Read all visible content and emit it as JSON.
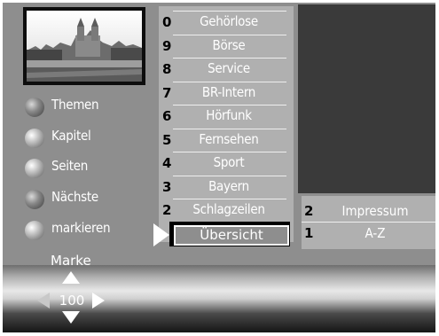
{
  "menu": [
    {
      "label": "Themen"
    },
    {
      "label": "Kapitel"
    },
    {
      "label": "Seiten"
    },
    {
      "label": "Nächste"
    },
    {
      "label": "markieren"
    }
  ],
  "marke_label": "Marke",
  "list": [
    {
      "num": "0",
      "name": "Gehörlose"
    },
    {
      "num": "9",
      "name": "Börse"
    },
    {
      "num": "8",
      "name": "Service"
    },
    {
      "num": "7",
      "name": "BR-Intern"
    },
    {
      "num": "6",
      "name": "Hörfunk"
    },
    {
      "num": "5",
      "name": "Fernsehen"
    },
    {
      "num": "4",
      "name": "Sport"
    },
    {
      "num": "3",
      "name": "Bayern"
    },
    {
      "num": "2",
      "name": "Schlagzeilen"
    }
  ],
  "selected": {
    "name": "Übersicht"
  },
  "submenu": [
    {
      "num": "2",
      "name": "Impressum"
    },
    {
      "num": "1",
      "name": "A-Z"
    }
  ],
  "page_number": "100",
  "colors": {
    "panel": "#8e8e8e",
    "list_bg": "#b0b0b0",
    "preview": "#3a3a3a"
  }
}
